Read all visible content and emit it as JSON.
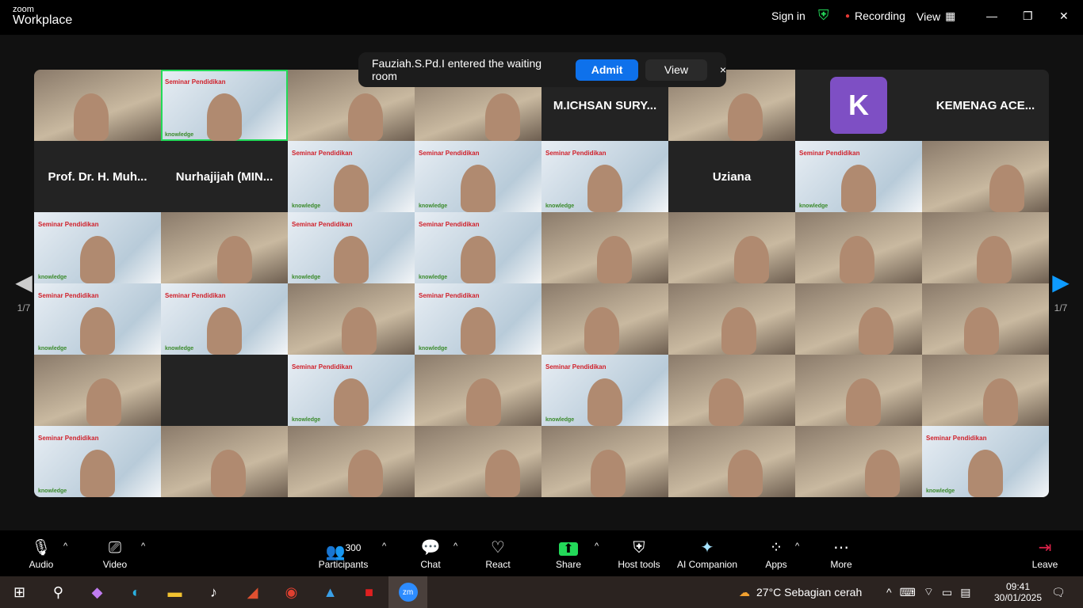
{
  "app": {
    "logo_small": "zoom",
    "logo_big": "Workplace"
  },
  "topbar": {
    "sign_in": "Sign in",
    "recording": "Recording",
    "view": "View",
    "recording_color": "#e53935",
    "shield_color": "#23d959"
  },
  "notification": {
    "message": "Fauziah.S.Pd.I entered the waiting room",
    "admit": "Admit",
    "view": "View",
    "close": "×"
  },
  "pagination": {
    "left": "1/7",
    "right": "1/7"
  },
  "tiles": [
    {
      "type": "vid"
    },
    {
      "type": "slide",
      "active": true
    },
    {
      "type": "vid"
    },
    {
      "type": "vid"
    },
    {
      "type": "name",
      "name": "M.ICHSAN SURY..."
    },
    {
      "type": "vid"
    },
    {
      "type": "avatar",
      "letter": "K"
    },
    {
      "type": "name",
      "name": "KEMENAG ACE..."
    },
    {
      "type": "name",
      "name": "Prof. Dr. H. Muh..."
    },
    {
      "type": "name",
      "name": "Nurhajijah (MIN..."
    },
    {
      "type": "slide"
    },
    {
      "type": "slide"
    },
    {
      "type": "slide"
    },
    {
      "type": "name",
      "name": "Uziana"
    },
    {
      "type": "slide"
    },
    {
      "type": "vid"
    },
    {
      "type": "slide"
    },
    {
      "type": "vid"
    },
    {
      "type": "slide"
    },
    {
      "type": "slide"
    },
    {
      "type": "vid"
    },
    {
      "type": "vid"
    },
    {
      "type": "vid"
    },
    {
      "type": "vid"
    },
    {
      "type": "slide"
    },
    {
      "type": "slide"
    },
    {
      "type": "vid"
    },
    {
      "type": "slide"
    },
    {
      "type": "vid"
    },
    {
      "type": "vid"
    },
    {
      "type": "vid"
    },
    {
      "type": "vid"
    },
    {
      "type": "vid"
    },
    {
      "type": "empty"
    },
    {
      "type": "slide"
    },
    {
      "type": "vid"
    },
    {
      "type": "slide"
    },
    {
      "type": "vid"
    },
    {
      "type": "vid"
    },
    {
      "type": "vid"
    },
    {
      "type": "slide"
    },
    {
      "type": "vid"
    },
    {
      "type": "vid"
    },
    {
      "type": "vid"
    },
    {
      "type": "vid"
    },
    {
      "type": "vid"
    },
    {
      "type": "vid"
    },
    {
      "type": "slide"
    }
  ],
  "slide": {
    "title": "Seminar Pendidikan",
    "brand": "knowledge"
  },
  "toolbar": {
    "audio": "Audio",
    "video": "Video",
    "participants": "Participants",
    "participants_count": "300",
    "chat": "Chat",
    "react": "React",
    "share": "Share",
    "host_tools": "Host tools",
    "ai": "AI Companion",
    "apps": "Apps",
    "more": "More",
    "leave": "Leave",
    "share_color": "#23d959"
  },
  "taskbar": {
    "weather": "27°C  Sebagian cerah",
    "time": "09:41",
    "date": "30/01/2025",
    "zoom_label": "zm"
  }
}
